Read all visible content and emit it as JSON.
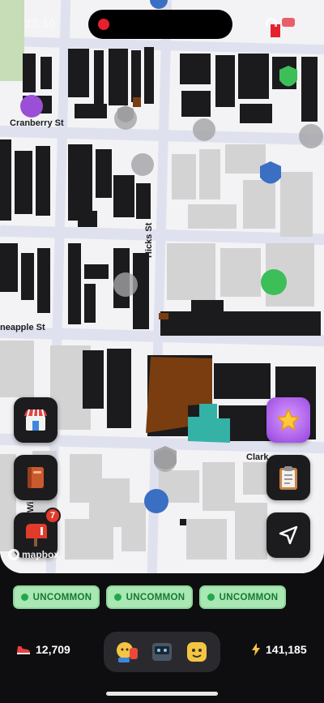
{
  "status": {
    "time": "23:10"
  },
  "map": {
    "streets": {
      "cranberry": "Cranberry St",
      "hicks": "Hicks St",
      "pineapple": "neapple St",
      "clark": "Clark",
      "willow_partial": "Wi"
    },
    "attribution": "mapbox",
    "colors": {
      "building_dark": "#1b1b1d",
      "building_light": "#d3d3d4",
      "road": "#dee1ee",
      "highlight_brown": "#7a3d0f",
      "highlight_teal": "#34b2a5",
      "marker_purple": "#9b4fd6",
      "marker_green": "#3cbf58",
      "marker_blue": "#3a6fc4"
    }
  },
  "side_buttons": {
    "left": [
      {
        "name": "store",
        "icon": "store-icon"
      },
      {
        "name": "journal",
        "icon": "book-icon"
      },
      {
        "name": "mailbox",
        "icon": "mailbox-icon",
        "badge": "7"
      }
    ],
    "right": [
      {
        "name": "rewards",
        "icon": "star-icon"
      },
      {
        "name": "quests",
        "icon": "clipboard-icon"
      },
      {
        "name": "locate",
        "icon": "location-arrow-icon"
      }
    ]
  },
  "rarity": [
    "UNCOMMON",
    "UNCOMMON",
    "UNCOMMON"
  ],
  "stats": {
    "steps": "12,709",
    "energy": "141,185"
  }
}
